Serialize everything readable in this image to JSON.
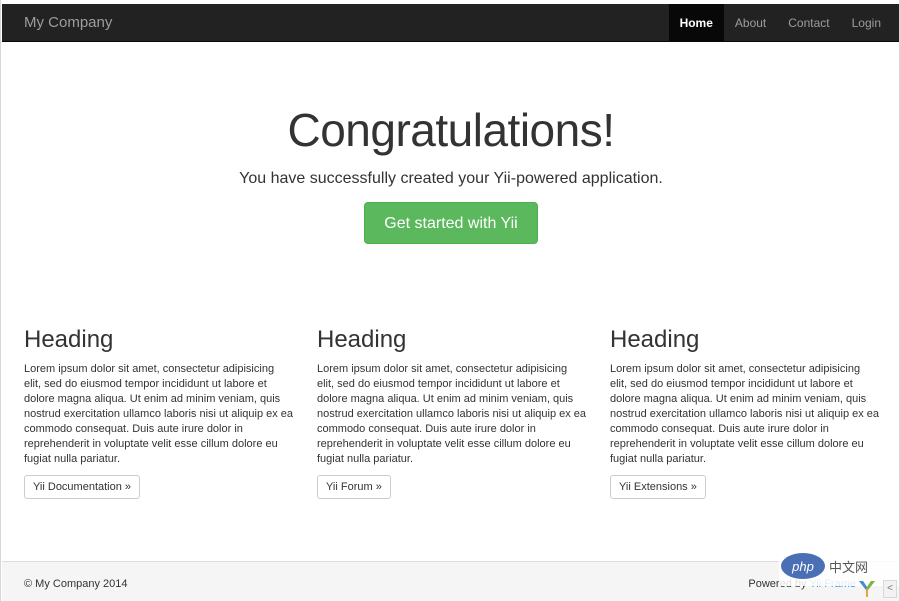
{
  "navbar": {
    "brand": "My Company",
    "items": [
      {
        "label": "Home",
        "active": true
      },
      {
        "label": "About",
        "active": false
      },
      {
        "label": "Contact",
        "active": false
      },
      {
        "label": "Login",
        "active": false
      }
    ]
  },
  "jumbotron": {
    "title": "Congratulations!",
    "lead": "You have successfully created your Yii-powered application.",
    "button": "Get started with Yii"
  },
  "columns": [
    {
      "heading": "Heading",
      "text": "Lorem ipsum dolor sit amet, consectetur adipisicing elit, sed do eiusmod tempor incididunt ut labore et dolore magna aliqua. Ut enim ad minim veniam, quis nostrud exercitation ullamco laboris nisi ut aliquip ex ea commodo consequat. Duis aute irure dolor in reprehenderit in voluptate velit esse cillum dolore eu fugiat nulla pariatur.",
      "button": "Yii Documentation »"
    },
    {
      "heading": "Heading",
      "text": "Lorem ipsum dolor sit amet, consectetur adipisicing elit, sed do eiusmod tempor incididunt ut labore et dolore magna aliqua. Ut enim ad minim veniam, quis nostrud exercitation ullamco laboris nisi ut aliquip ex ea commodo consequat. Duis aute irure dolor in reprehenderit in voluptate velit esse cillum dolore eu fugiat nulla pariatur.",
      "button": "Yii Forum »"
    },
    {
      "heading": "Heading",
      "text": "Lorem ipsum dolor sit amet, consectetur adipisicing elit, sed do eiusmod tempor incididunt ut labore et dolore magna aliqua. Ut enim ad minim veniam, quis nostrud exercitation ullamco laboris nisi ut aliquip ex ea commodo consequat. Duis aute irure dolor in reprehenderit in voluptate velit esse cillum dolore eu fugiat nulla pariatur.",
      "button": "Yii Extensions »"
    }
  ],
  "footer": {
    "copyright": "© My Company 2014",
    "powered_prefix": "Powered by ",
    "powered_link": "Yii Frame"
  },
  "watermark": {
    "logo": "php",
    "text": "中文网"
  },
  "colors": {
    "navbar_bg": "#222222",
    "success": "#5cb85c",
    "link": "#428bca",
    "footer_bg": "#f5f5f5"
  },
  "icons": {
    "yii_logo": "yii-logo-icon",
    "scroll_up": "chevron-up-icon"
  }
}
